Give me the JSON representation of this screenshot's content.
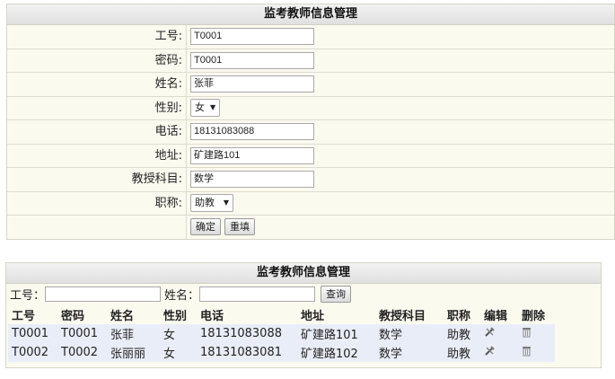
{
  "form": {
    "title": "监考教师信息管理",
    "fields": [
      {
        "label": "工号:",
        "value": "T0001"
      },
      {
        "label": "密码:",
        "value": "T0001"
      },
      {
        "label": "姓名:",
        "value": "张菲"
      },
      {
        "label": "性别:",
        "value": "女"
      },
      {
        "label": "电话:",
        "value": "18131083088"
      },
      {
        "label": "地址:",
        "value": "矿建路101"
      },
      {
        "label": "教授科目:",
        "value": "数学"
      },
      {
        "label": "职称:",
        "value": "助教"
      }
    ],
    "confirm_label": "确定",
    "reset_label": "重填"
  },
  "list": {
    "title": "监考教师信息管理",
    "search": {
      "id_label": "工号：",
      "id_value": "",
      "name_label": "姓名：",
      "name_value": "",
      "button_label": "查询"
    },
    "headers": [
      "工号",
      "密码",
      "姓名",
      "性别",
      "电话",
      "地址",
      "教授科目",
      "职称",
      "编辑",
      "删除"
    ],
    "rows": [
      [
        "T0001",
        "T0001",
        "张菲",
        "女",
        "18131083088",
        "矿建路101",
        "数学",
        "助教"
      ],
      [
        "T0002",
        "T0002",
        "张丽丽",
        "女",
        "18131083081",
        "矿建路102",
        "数学",
        "助教"
      ]
    ],
    "edit_icon": "edit-tools-icon",
    "delete_icon": "trash-icon"
  }
}
